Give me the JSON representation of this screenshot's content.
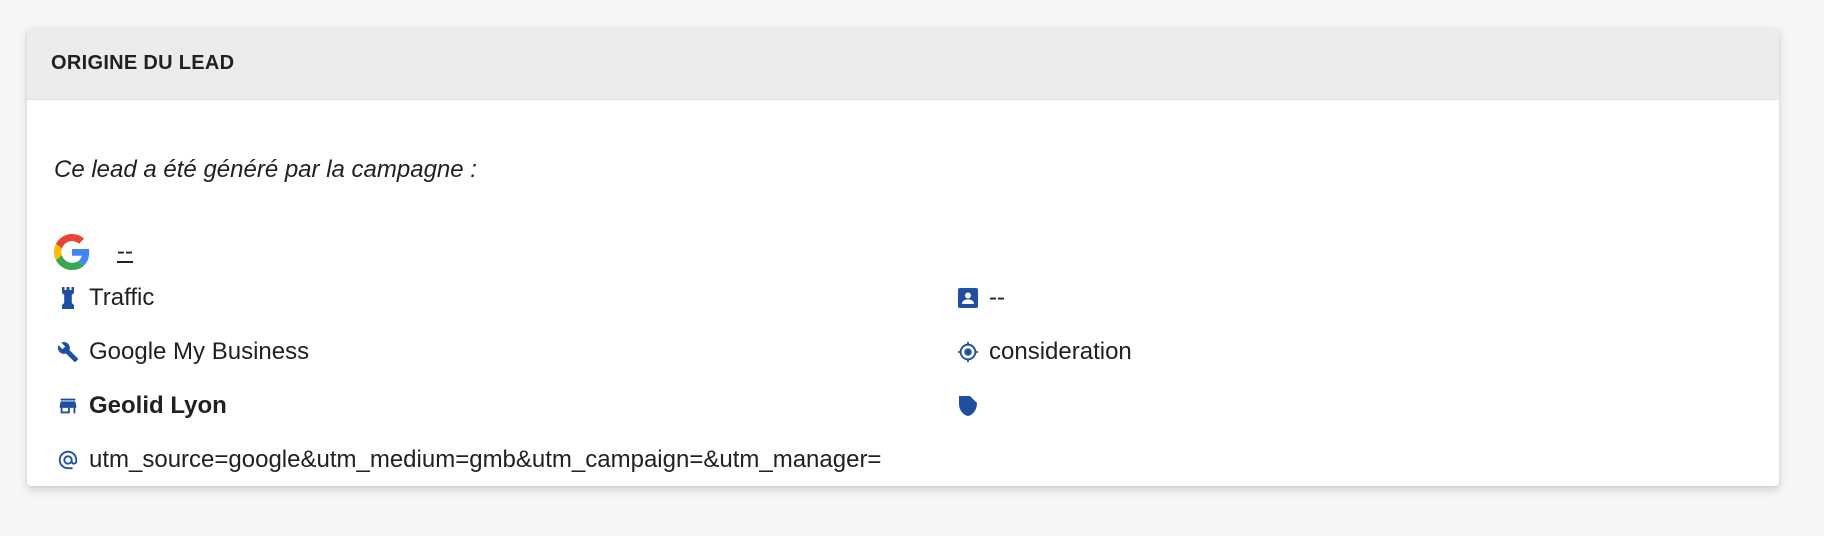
{
  "panel": {
    "title": "ORIGINE DU LEAD",
    "intro": "Ce lead a été généré par la campagne :",
    "campaign": {
      "icon": "google-g-icon",
      "link_text": "--"
    },
    "left_items": [
      {
        "icon": "rook-icon",
        "label": "Traffic",
        "bold": false
      },
      {
        "icon": "wrench-icon",
        "label": "Google My Business",
        "bold": false
      },
      {
        "icon": "store-icon",
        "label": "Geolid Lyon",
        "bold": true
      },
      {
        "icon": "at-sign-icon",
        "label": "utm_source=google&utm_medium=gmb&utm_campaign=&utm_manager=",
        "bold": false
      }
    ],
    "right_items": [
      {
        "icon": "contact-card-icon",
        "label": "--"
      },
      {
        "icon": "target-icon",
        "label": "consideration"
      },
      {
        "icon": "badge-icon",
        "label": ""
      }
    ]
  },
  "colors": {
    "icon_blue": "#1f4fa0",
    "header_bg": "#ececec",
    "text": "#212121",
    "google_blue": "#4285F4",
    "google_red": "#EA4335",
    "google_yellow": "#FBBC05",
    "google_green": "#34A853"
  }
}
